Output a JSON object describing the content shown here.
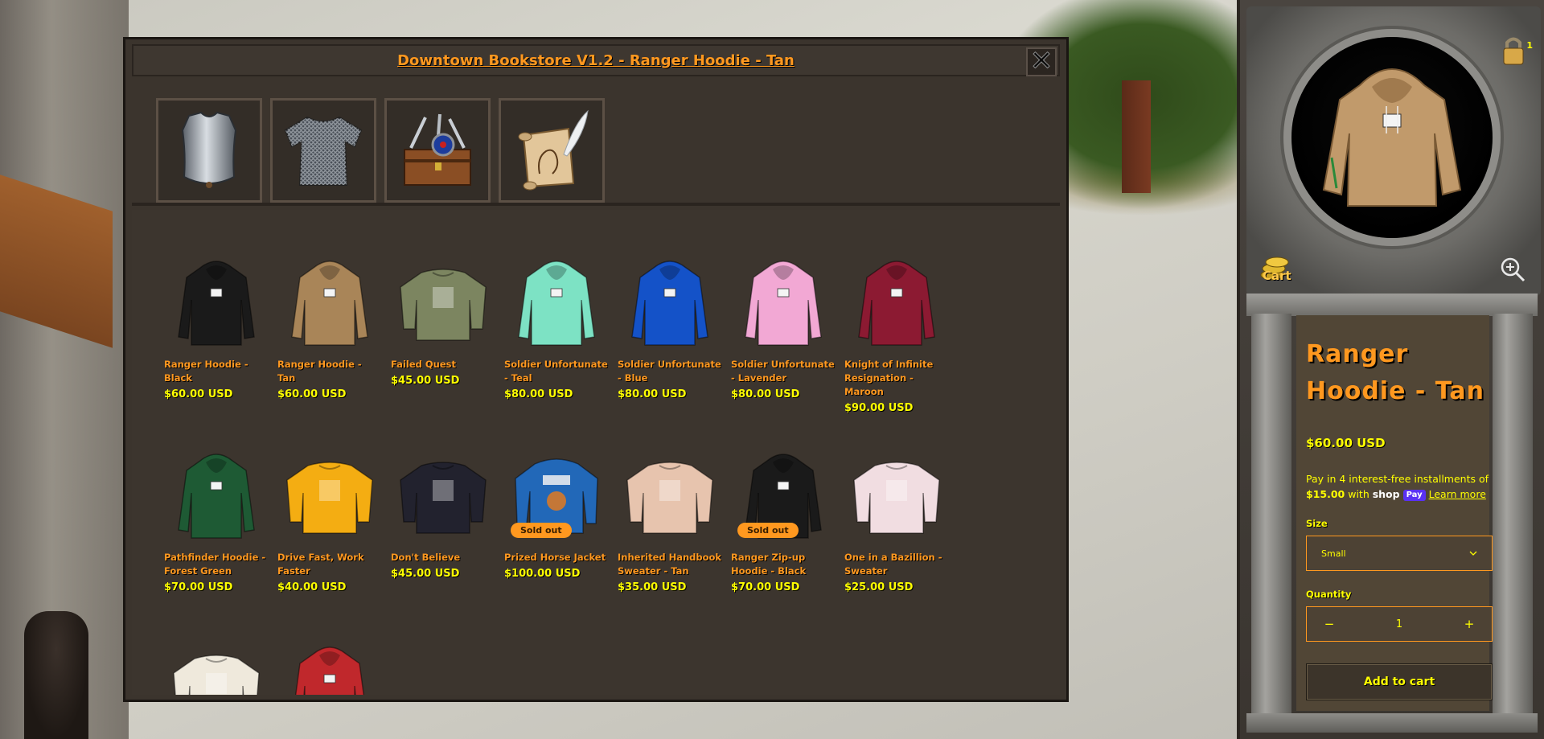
{
  "window": {
    "title": "Downtown Bookstore V1.2 - Ranger Hoodie - Tan",
    "close_label": "✕"
  },
  "category_tabs": [
    {
      "name": "armor-plate-icon"
    },
    {
      "name": "chainmail-shirt-icon"
    },
    {
      "name": "treasure-chest-icon"
    },
    {
      "name": "scroll-quill-icon"
    }
  ],
  "products": [
    {
      "name": "Ranger Hoodie - Black",
      "price": "$60.00 USD",
      "color": "#1a1a1a",
      "type": "hoodie",
      "sold_out": false
    },
    {
      "name": "Ranger Hoodie - Tan",
      "price": "$60.00 USD",
      "color": "#a98558",
      "type": "hoodie",
      "sold_out": false
    },
    {
      "name": "Failed Quest",
      "price": "$45.00 USD",
      "color": "#7c8560",
      "type": "sweater",
      "sold_out": false
    },
    {
      "name": "Soldier Unfortunate - Teal",
      "price": "$80.00 USD",
      "color": "#7de2c4",
      "type": "hoodie",
      "sold_out": false
    },
    {
      "name": "Soldier Unfortunate - Blue",
      "price": "$80.00 USD",
      "color": "#1452c8",
      "type": "hoodie",
      "sold_out": false
    },
    {
      "name": "Soldier Unfortunate - Lavender",
      "price": "$80.00 USD",
      "color": "#f2a8d4",
      "type": "hoodie",
      "sold_out": false
    },
    {
      "name": "Knight of Infinite Resignation - Maroon",
      "price": "$90.00 USD",
      "color": "#8c1a32",
      "type": "hoodie",
      "sold_out": false
    },
    {
      "name": "Pathfinder Hoodie - Forest Green",
      "price": "$70.00 USD",
      "color": "#1e5a34",
      "type": "hoodie",
      "sold_out": false
    },
    {
      "name": "Drive Fast, Work Faster",
      "price": "$40.00 USD",
      "color": "#f4ad12",
      "type": "sweater",
      "sold_out": false
    },
    {
      "name": "Don't Believe",
      "price": "$45.00 USD",
      "color": "#22222e",
      "type": "sweater",
      "sold_out": false
    },
    {
      "name": "Prized Horse Jacket",
      "price": "$100.00 USD",
      "color": "#2268b8",
      "type": "jacket",
      "sold_out": true
    },
    {
      "name": "Inherited Handbook Sweater - Tan",
      "price": "$35.00 USD",
      "color": "#e7c4ae",
      "type": "sweater",
      "sold_out": false
    },
    {
      "name": "Ranger Zip-up Hoodie - Black",
      "price": "$70.00 USD",
      "color": "#1a1a1a",
      "type": "hoodie",
      "sold_out": true
    },
    {
      "name": "One in a Bazillion - Sweater",
      "price": "$25.00 USD",
      "color": "#f1dde1",
      "type": "sweater",
      "sold_out": false
    },
    {
      "name": "",
      "price": "",
      "color": "#efe9dc",
      "type": "sweater",
      "sold_out": false
    },
    {
      "name": "",
      "price": "",
      "color": "#c0282c",
      "type": "hoodie",
      "sold_out": false
    }
  ],
  "sold_out_label": "Sold out",
  "detail": {
    "title": "Ranger Hoodie - Tan",
    "price": "$60.00 USD",
    "installments_prefix": "Pay in 4 interest-free installments of ",
    "installments_amount": "$15.00",
    "installments_with": " with ",
    "shop_word": "shop",
    "shop_badge": "Pay",
    "learn_more": "Learn more",
    "size_label": "Size",
    "size_value": "Small",
    "quantity_label": "Quantity",
    "quantity_value": "1",
    "qty_minus": "−",
    "qty_plus": "+",
    "add_to_cart": "Add to cart",
    "cart_label": "Cart",
    "lock_count": "1"
  },
  "colors": {
    "accent_orange": "#ff981f",
    "accent_yellow": "#ffff00",
    "panel_brown": "#3b342d"
  }
}
